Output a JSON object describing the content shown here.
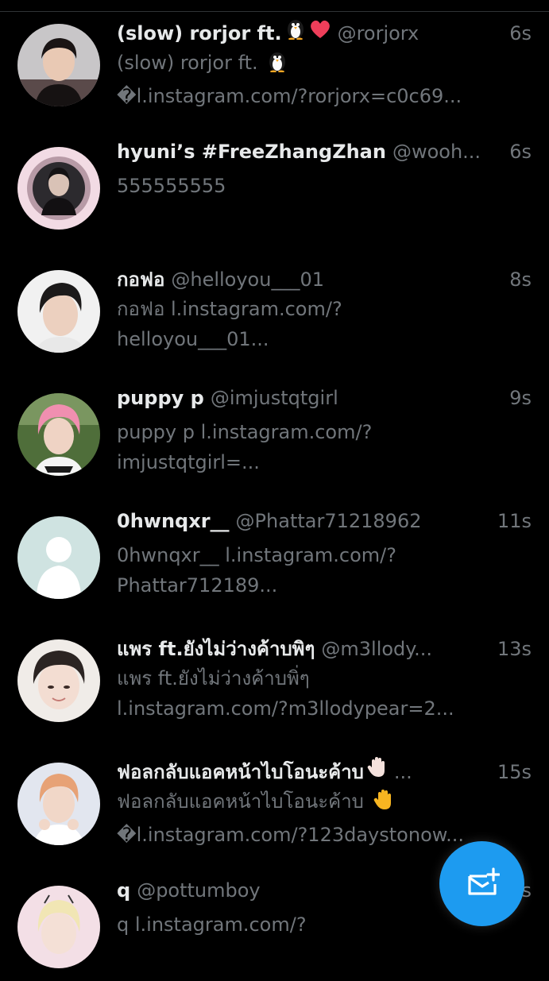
{
  "colors": {
    "background": "#000000",
    "name": "#e7e9ea",
    "muted": "#71767b",
    "accent": "#1d9bf0"
  },
  "conversations": [
    {
      "name": "(slow) rorjor ft.",
      "name_emojis": [
        "penguin-icon",
        "heart-icon"
      ],
      "handle": "@rorjorx",
      "time": "6s",
      "preview1": "(slow) rorjor ft.",
      "preview1_emoji": "penguin-icon",
      "preview2": "�l.instagram.com/?rorjorx=c0c69..."
    },
    {
      "name": "hyuni’s #FreeZhangZhan",
      "handle": "@wooh...",
      "time": "6s",
      "preview1": "555555555",
      "preview2": ""
    },
    {
      "name": "กอฟอ",
      "handle": "@helloyou___01",
      "time": "8s",
      "preview1": "กอฟอ l.instagram.com/?",
      "preview2": "helloyou___01..."
    },
    {
      "name": "puppy p",
      "handle": "@imjustqtgirl",
      "time": "9s",
      "preview1": "puppy p l.instagram.com/?",
      "preview2": "imjustqtgirl=..."
    },
    {
      "name": "0hwnqxr__",
      "handle": "@Phattar71218962",
      "time": "11s",
      "preview1": "0hwnqxr__ l.instagram.com/?",
      "preview2": "Phattar712189..."
    },
    {
      "name": "แพร ft.ยังไม่ว่างค้าบพิๆ",
      "handle": "@m3llody...",
      "time": "13s",
      "preview1": "แพร ft.ยังไม่ว่างค้าบพิ่ๆ",
      "preview2": "l.instagram.com/?m3llodypear=2..."
    },
    {
      "name": "ฟอลกลับแอคหน้าไบโอนะค้าบ",
      "name_emojis": [
        "raised-hand-icon"
      ],
      "handle": "...",
      "time": "15s",
      "preview1": "ฟอลกลับแอคหน้าไบโอนะค้าบ",
      "preview1_emoji": "raised-hand-icon",
      "preview2": "�l.instagram.com/?123daystonow..."
    },
    {
      "name": "q",
      "handle": "@pottumboy",
      "time": "16s",
      "preview1": "q l.instagram.com/?",
      "preview2": ""
    }
  ],
  "fab": {
    "icon": "new-message-icon"
  }
}
